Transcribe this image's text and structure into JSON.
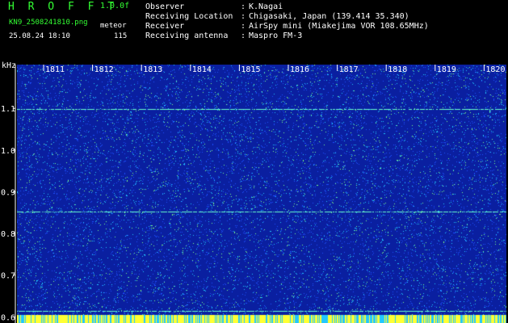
{
  "header": {
    "title": "H R O F F T",
    "version": "1.0.0f",
    "filename": "KN9_2508241810.png",
    "mode": "meteor",
    "datetime": "25.08.24 18:10",
    "count": "115",
    "info_rows": [
      {
        "label": "Observer",
        "value": "K.Nagai"
      },
      {
        "label": "Receiving Location",
        "value": "Chigasaki, Japan (139.414 35.340)"
      },
      {
        "label": "Receiver",
        "value": "AirSpy mini (Miakejima VOR 108.65MHz)"
      },
      {
        "label": "Receiving antenna",
        "value": "Maspro FM-3"
      }
    ],
    "separator": ":"
  },
  "axis": {
    "unit": "kHz",
    "time_ticks": [
      "1811",
      "1812",
      "1813",
      "1814",
      "1815",
      "1816",
      "1817",
      "1818",
      "1819",
      "1820"
    ],
    "freq_ticks": [
      {
        "label": "1.1",
        "value": 1.1
      },
      {
        "label": "1.0",
        "value": 1.0
      },
      {
        "label": "0.9",
        "value": 0.9
      },
      {
        "label": "0.8",
        "value": 0.8
      },
      {
        "label": "0.7",
        "value": 0.7
      },
      {
        "label": "0.6",
        "value": 0.6
      }
    ],
    "freq_range": [
      0.585,
      1.205
    ]
  },
  "colors": {
    "background": "#000000",
    "waterfall_base": "#0a1fa0",
    "noise_light": "#1f4fff",
    "noise_cyan": "#22c8ff",
    "noise_green": "#7dff8a",
    "carrier_line": "#66ffcc",
    "bottom_band": "#ffff33"
  },
  "carriers_khz": [
    1.098,
    0.852,
    0.615,
    0.6
  ]
}
